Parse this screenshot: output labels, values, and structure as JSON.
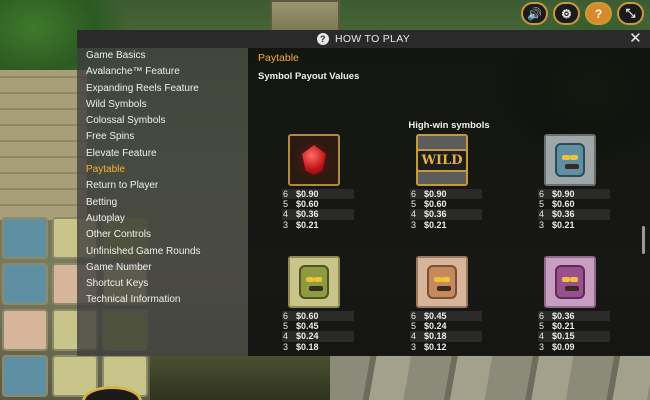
{
  "controls": [
    {
      "icon": "speaker-icon",
      "glyph": "🔊"
    },
    {
      "icon": "gear-icon",
      "glyph": "⚙"
    },
    {
      "icon": "help-icon",
      "glyph": "?"
    },
    {
      "icon": "collapse-icon",
      "glyph": "⤡"
    }
  ],
  "dialog": {
    "title": "HOW TO PLAY",
    "close_glyph": "✕",
    "help_glyph": "?"
  },
  "nav": {
    "active": "Paytable",
    "items": [
      "Game Basics",
      "Avalanche™ Feature",
      "Expanding Reels Feature",
      "Wild Symbols",
      "Colossal Symbols",
      "Free Spins",
      "Elevate Feature",
      "Paytable",
      "Return to Player",
      "Betting",
      "Autoplay",
      "Other Controls",
      "Unfinished Game Rounds",
      "Game Number",
      "Shortcut Keys",
      "Technical Information"
    ]
  },
  "content": {
    "heading": "Paytable",
    "subheading": "Symbol Payout Values",
    "group_title": "High-win symbols",
    "symbols": [
      {
        "name": "red-gem-symbol",
        "style": "ruby",
        "payouts": [
          {
            "count": "6",
            "value": "$0.90"
          },
          {
            "count": "5",
            "value": "$0.60"
          },
          {
            "count": "4",
            "value": "$0.36"
          },
          {
            "count": "3",
            "value": "$0.21"
          }
        ]
      },
      {
        "name": "wild-symbol",
        "style": "wild",
        "label": "WILD",
        "payouts": [
          {
            "count": "6",
            "value": "$0.90"
          },
          {
            "count": "5",
            "value": "$0.60"
          },
          {
            "count": "4",
            "value": "$0.36"
          },
          {
            "count": "3",
            "value": "$0.21"
          }
        ]
      },
      {
        "name": "blue-mask-symbol",
        "style": "blue",
        "payouts": [
          {
            "count": "6",
            "value": "$0.90"
          },
          {
            "count": "5",
            "value": "$0.60"
          },
          {
            "count": "4",
            "value": "$0.36"
          },
          {
            "count": "3",
            "value": "$0.21"
          }
        ]
      },
      {
        "name": "green-mask-symbol",
        "style": "green",
        "payouts": [
          {
            "count": "6",
            "value": "$0.60"
          },
          {
            "count": "5",
            "value": "$0.45"
          },
          {
            "count": "4",
            "value": "$0.24"
          },
          {
            "count": "3",
            "value": "$0.18"
          }
        ]
      },
      {
        "name": "peach-mask-symbol",
        "style": "peach",
        "payouts": [
          {
            "count": "6",
            "value": "$0.45"
          },
          {
            "count": "5",
            "value": "$0.24"
          },
          {
            "count": "4",
            "value": "$0.18"
          },
          {
            "count": "3",
            "value": "$0.12"
          }
        ]
      },
      {
        "name": "purple-mask-symbol",
        "style": "purple",
        "payouts": [
          {
            "count": "6",
            "value": "$0.36"
          },
          {
            "count": "5",
            "value": "$0.21"
          },
          {
            "count": "4",
            "value": "$0.15"
          },
          {
            "count": "3",
            "value": "$0.09"
          }
        ]
      }
    ]
  },
  "colors": {
    "accent": "#f2b233",
    "panel": "#0c0c0c",
    "nav_bg": "#3c3c3c",
    "button_border": "#c79b3c"
  }
}
